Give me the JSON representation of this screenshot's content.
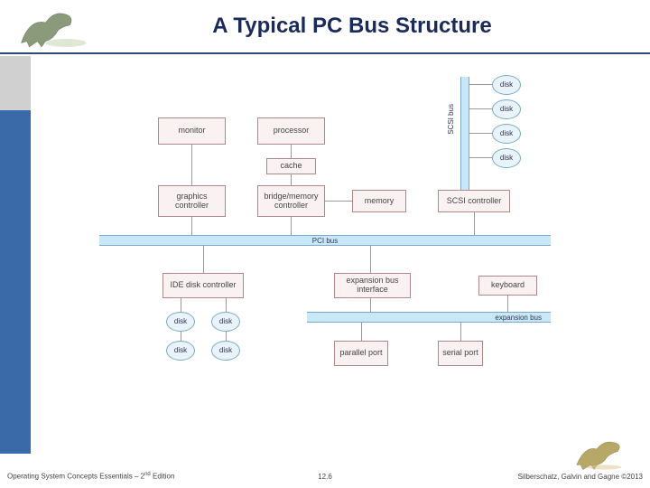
{
  "header": {
    "title": "A Typical PC Bus Structure"
  },
  "diagram": {
    "boxes": {
      "monitor": "monitor",
      "processor": "processor",
      "cache": "cache",
      "graphics": "graphics controller",
      "bridge": "bridge/memory controller",
      "memory": "memory",
      "scsi_ctrl": "SCSI controller",
      "ide": "IDE disk controller",
      "exp_iface": "expansion bus interface",
      "keyboard": "keyboard",
      "parallel": "parallel port",
      "serial": "serial port"
    },
    "disks": {
      "scsi1": "disk",
      "scsi2": "disk",
      "scsi3": "disk",
      "scsi4": "disk",
      "ide1": "disk",
      "ide2": "disk",
      "ide3": "disk",
      "ide4": "disk"
    },
    "buses": {
      "pci": "PCI bus",
      "expansion": "expansion bus",
      "scsi": "SCSI bus"
    }
  },
  "footer": {
    "left_a": "Operating System Concepts Essentials  – 2",
    "left_sup": "nd",
    "left_b": " Edition",
    "center": "12.6",
    "right_a": "Silberschatz, Galvin and Gagne ",
    "right_b": "©",
    "right_c": "2013"
  }
}
